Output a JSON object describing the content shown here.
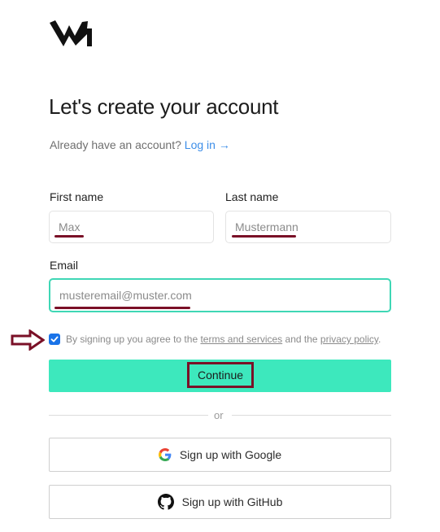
{
  "brand": {
    "logo_icon": "w-logo-icon"
  },
  "heading": {
    "title": "Let's create your account"
  },
  "login_prompt": {
    "text": "Already have an account?",
    "link_label": "Log in →"
  },
  "form": {
    "first_name": {
      "label": "First name",
      "value": "Max"
    },
    "last_name": {
      "label": "Last name",
      "value": "Mustermann"
    },
    "email": {
      "label": "Email",
      "value": "musteremail@muster.com"
    }
  },
  "consent": {
    "checked": true,
    "prefix": "By signing up you agree to the",
    "terms_link": "terms and services",
    "middle": "and the",
    "privacy_link": "privacy policy",
    "suffix": "."
  },
  "actions": {
    "continue_label": "Continue",
    "divider_text": "or"
  },
  "social": {
    "google_label": "Sign up with Google",
    "github_label": "Sign up with GitHub"
  },
  "annotations": {
    "highlight_color": "#7a1027",
    "arrow_icon": "right-arrow-annotation-icon"
  },
  "colors": {
    "accent": "#3de8bd",
    "focus_border": "#3fd7b5",
    "link": "#3d8ee8",
    "checkbox": "#1a73e8"
  }
}
